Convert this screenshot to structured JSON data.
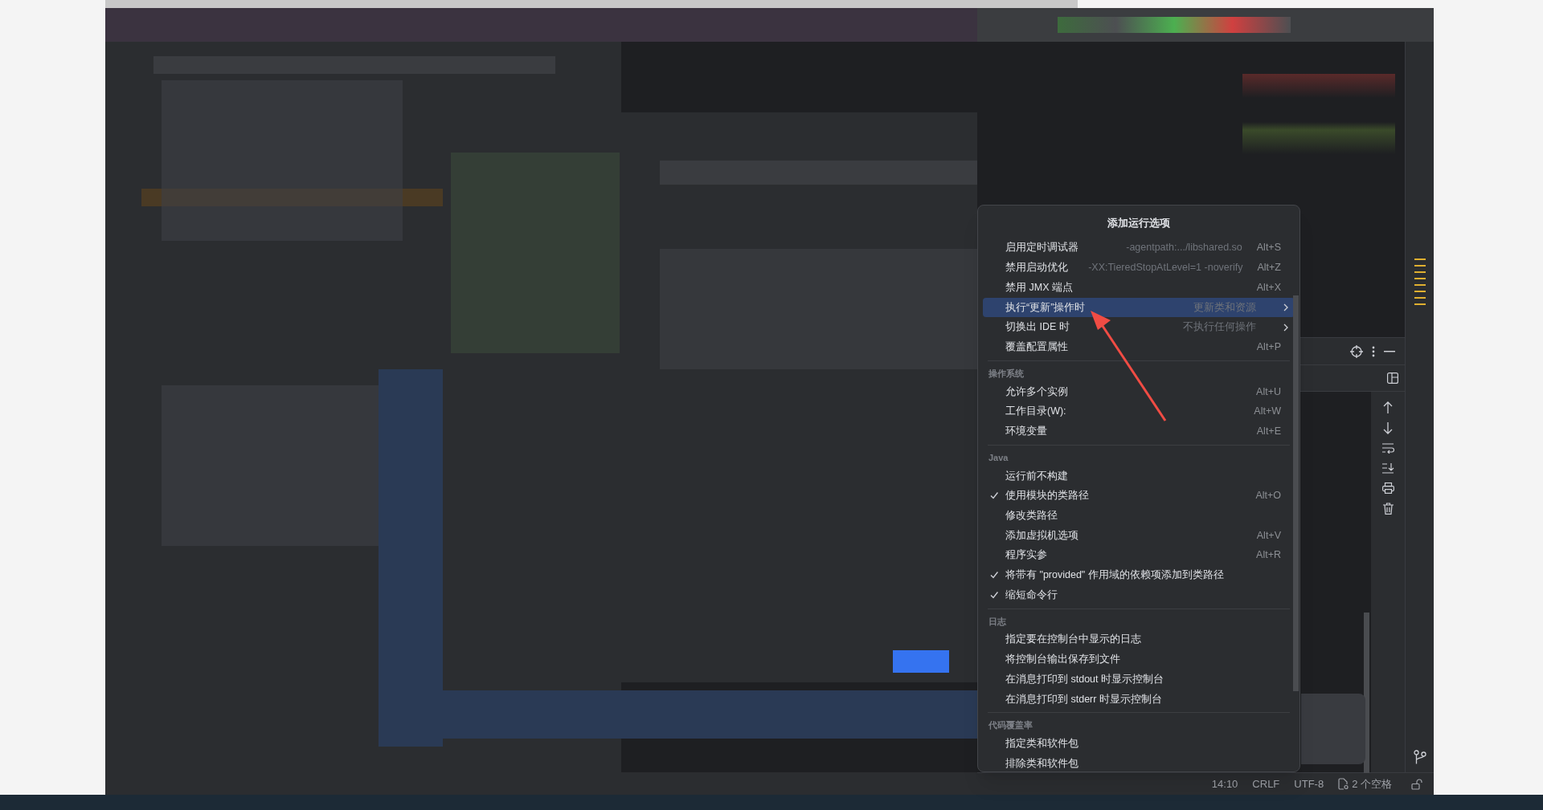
{
  "menu": {
    "title": "添加运行选项",
    "sections": [
      {
        "items": [
          {
            "kind": "item",
            "label": "启用定时调试器",
            "hint": "-agentpath:.../libshared.so",
            "shortcut": "Alt+S",
            "checked": false,
            "selected": false
          },
          {
            "kind": "item",
            "label": "禁用启动优化",
            "hint": "-XX:TieredStopAtLevel=1 -noverify",
            "shortcut": "Alt+Z",
            "checked": false,
            "selected": false
          },
          {
            "kind": "item",
            "label": "禁用 JMX 端点",
            "shortcut": "Alt+X",
            "checked": false,
            "selected": false
          },
          {
            "kind": "submenu",
            "label": "执行“更新”操作时",
            "hint": "更新类和资源",
            "checked": false,
            "selected": true
          },
          {
            "kind": "submenu",
            "label": "切换出 IDE 时",
            "hint": "不执行任何操作",
            "checked": false,
            "selected": false
          },
          {
            "kind": "item",
            "label": "覆盖配置属性",
            "shortcut": "Alt+P",
            "checked": false,
            "selected": false
          }
        ]
      },
      {
        "heading": "操作系统",
        "items": [
          {
            "kind": "item",
            "label": "允许多个实例",
            "shortcut": "Alt+U",
            "checked": false,
            "selected": false
          },
          {
            "kind": "item",
            "label": "工作目录(W):",
            "shortcut": "Alt+W",
            "checked": false,
            "selected": false
          },
          {
            "kind": "item",
            "label": "环境变量",
            "shortcut": "Alt+E",
            "checked": false,
            "selected": false
          }
        ]
      },
      {
        "heading": "Java",
        "items": [
          {
            "kind": "item",
            "label": "运行前不构建",
            "checked": false,
            "selected": false
          },
          {
            "kind": "item",
            "label": "使用模块的类路径",
            "shortcut": "Alt+O",
            "checked": true,
            "selected": false
          },
          {
            "kind": "item",
            "label": "修改类路径",
            "checked": false,
            "selected": false
          },
          {
            "kind": "item",
            "label": "添加虚拟机选项",
            "shortcut": "Alt+V",
            "checked": false,
            "selected": false
          },
          {
            "kind": "item",
            "label": "程序实参",
            "shortcut": "Alt+R",
            "checked": false,
            "selected": false
          },
          {
            "kind": "item",
            "label": "将带有 \"provided\" 作用域的依赖项添加到类路径",
            "checked": true,
            "selected": false
          },
          {
            "kind": "item",
            "label": "缩短命令行",
            "checked": true,
            "selected": false
          }
        ]
      },
      {
        "heading": "日志",
        "items": [
          {
            "kind": "item",
            "label": "指定要在控制台中显示的日志",
            "checked": false,
            "selected": false
          },
          {
            "kind": "item",
            "label": "将控制台输出保存到文件",
            "checked": false,
            "selected": false
          },
          {
            "kind": "item",
            "label": "在消息打印到 stdout 时显示控制台",
            "checked": false,
            "selected": false
          },
          {
            "kind": "item",
            "label": "在消息打印到 stderr 时显示控制台",
            "checked": false,
            "selected": false
          }
        ]
      },
      {
        "heading": "代码覆盖率",
        "items": [
          {
            "kind": "item",
            "label": "指定类和软件包",
            "checked": false,
            "selected": false
          },
          {
            "kind": "item",
            "label": "排除类和软件包",
            "checked": false,
            "selected": false
          }
        ]
      }
    ]
  },
  "status_bar": [
    {
      "kind": "text",
      "text": "14:10"
    },
    {
      "kind": "text",
      "text": "CRLF"
    },
    {
      "kind": "text",
      "text": "UTF-8"
    },
    {
      "kind": "indent",
      "text": "2 个空格"
    }
  ]
}
